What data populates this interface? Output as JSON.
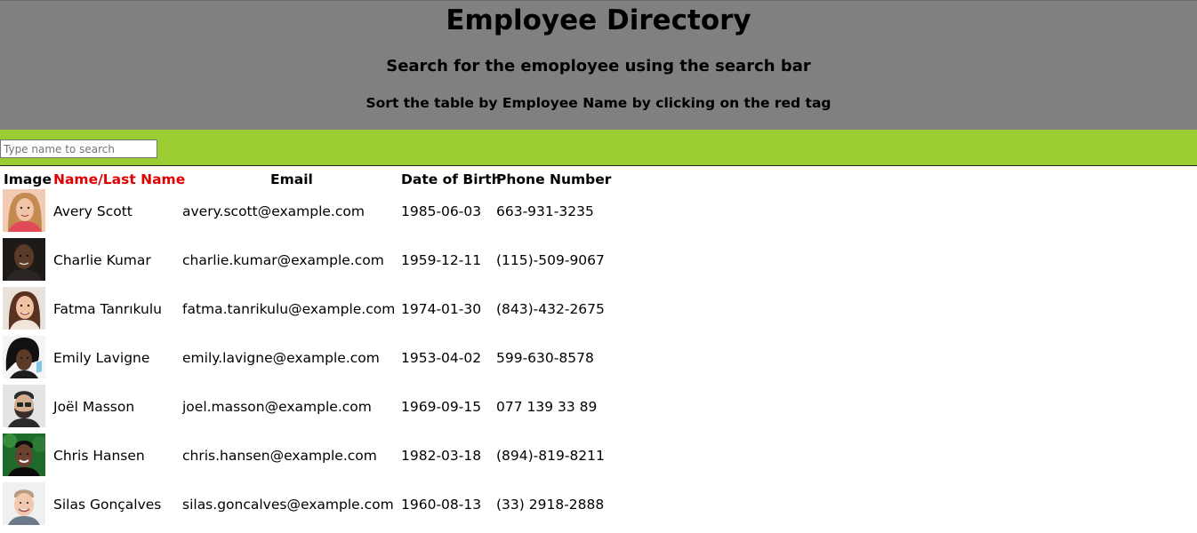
{
  "header": {
    "title": "Employee Directory",
    "subtitle": "Search for the emoployee using the search bar",
    "instruction": "Sort the table by Employee Name by clicking on the red tag"
  },
  "search": {
    "placeholder": "Type name to search",
    "value": ""
  },
  "table": {
    "columns": [
      "Image",
      "Name/Last Name",
      "Email",
      "Date of Birth",
      "Phone Number"
    ],
    "rows": [
      {
        "name": "Avery Scott",
        "email": "avery.scott@example.com",
        "dob": "1985-06-03",
        "phone": "663-931-3235",
        "avatar": "avatar-woman-blonde"
      },
      {
        "name": "Charlie Kumar",
        "email": "charlie.kumar@example.com",
        "dob": "1959-12-11",
        "phone": "(115)-509-9067",
        "avatar": "avatar-man-bald"
      },
      {
        "name": "Fatma Tanrıkulu",
        "email": "fatma.tanrikulu@example.com",
        "dob": "1974-01-30",
        "phone": "(843)-432-2675",
        "avatar": "avatar-woman-brunette"
      },
      {
        "name": "Emily Lavigne",
        "email": "emily.lavigne@example.com",
        "dob": "1953-04-02",
        "phone": "599-630-8578",
        "avatar": "avatar-woman-dark-hair"
      },
      {
        "name": "Joël Masson",
        "email": "joel.masson@example.com",
        "dob": "1969-09-15",
        "phone": "077 139 33 89",
        "avatar": "avatar-man-beard"
      },
      {
        "name": "Chris Hansen",
        "email": "chris.hansen@example.com",
        "dob": "1982-03-18",
        "phone": "(894)-819-8211",
        "avatar": "avatar-man-green"
      },
      {
        "name": "Silas Gonçalves",
        "email": "silas.goncalves@example.com",
        "dob": "1960-08-13",
        "phone": "(33) 2918-2888",
        "avatar": "avatar-man-smiling"
      }
    ]
  },
  "colors": {
    "header_bg": "#808080",
    "searchbar_bg": "#9acd32",
    "sort_tag": "#e00000"
  }
}
